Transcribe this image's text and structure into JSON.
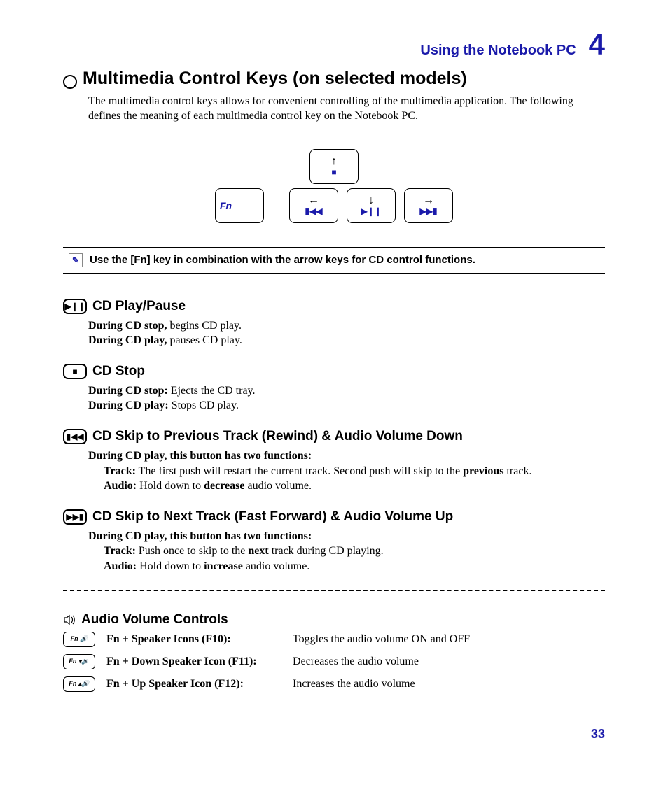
{
  "header": {
    "section_title": "Using the Notebook PC",
    "chapter_number": "4"
  },
  "title": "Multimedia Control Keys (on selected models)",
  "intro": "The multimedia control keys allows for convenient controlling of the multimedia application. The following defines the meaning of each multimedia control key on the Notebook PC.",
  "keycaps": {
    "fn_label": "Fn",
    "up_glyph": "■",
    "left_glyph": "▮◀◀",
    "down_glyph": "▶❙❙",
    "right_glyph": "▶▶▮"
  },
  "note": "Use the [Fn] key in combination with the arrow keys for CD control functions.",
  "sections": {
    "play_pause": {
      "title": "CD Play/Pause",
      "line1_b": "During CD stop,",
      "line1_t": " begins CD play.",
      "line2_b": "During CD play,",
      "line2_t": " pauses CD play."
    },
    "stop": {
      "title": "CD Stop",
      "line1_b": "During CD stop:",
      "line1_t": " Ejects the CD tray.",
      "line2_b": "During CD play:",
      "line2_t": " Stops CD play."
    },
    "prev": {
      "title": "CD Skip to Previous Track (Rewind) & Audio Volume Down",
      "intro": "During CD play, this button has two functions:",
      "track_b": "Track:",
      "track_t1": " The first push will restart the current track. Second push will skip to the ",
      "track_em": "previous",
      "track_t2": " track.",
      "audio_b": "Audio:",
      "audio_t1": " Hold down to ",
      "audio_em": "decrease",
      "audio_t2": " audio volume."
    },
    "next": {
      "title": "CD Skip to Next Track (Fast Forward) & Audio Volume Up",
      "intro": "During CD play, this button has two functions:",
      "track_b": "Track:",
      "track_t1": " Push once to skip to the ",
      "track_em": "next",
      "track_t2": " track during CD playing.",
      "audio_b": "Audio:",
      "audio_t1": " Hold down to ",
      "audio_em": "increase",
      "audio_t2": " audio volume."
    },
    "volume": {
      "title": "Audio Volume Controls",
      "rows": [
        {
          "key": "Fn + Speaker Icons (F10):",
          "desc": "Toggles the audio volume ON and OFF"
        },
        {
          "key": "Fn + Down Speaker Icon (F11):",
          "desc": "Decreases the audio volume"
        },
        {
          "key": "Fn + Up Speaker Icon (F12):",
          "desc": "Increases the audio volume"
        }
      ]
    }
  },
  "page_number": "33"
}
